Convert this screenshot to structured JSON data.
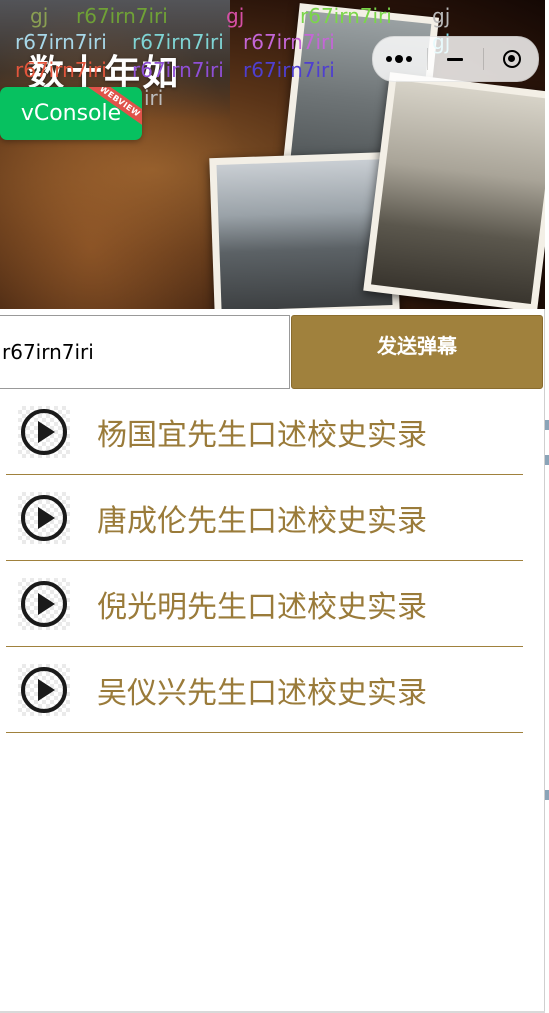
{
  "banner": {
    "title": "数十年如",
    "danmaku": [
      {
        "text": "gj",
        "color": "#8a9f52"
      },
      {
        "text": "r67irn7iri",
        "color": "#6fa136"
      },
      {
        "text": "gj",
        "color": "#d64fa5"
      },
      {
        "text": "r67irn7iri",
        "color": "#7bd64a"
      },
      {
        "text": "gj",
        "color": "#b9b9b9"
      },
      {
        "text": "r67irn7iri",
        "color": "#a7d7e8"
      },
      {
        "text": "r67irn7iri",
        "color": "#7fd4d4"
      },
      {
        "text": "r67irn7iri",
        "color": "#c466d6"
      },
      {
        "text": "gj",
        "color": "#7fe0ee"
      },
      {
        "text": "r67irn7iri",
        "color": "#e2553c"
      },
      {
        "text": "r67irn7iri",
        "color": "#8f4fd6"
      },
      {
        "text": "r67irn7iri",
        "color": "#4f3fcf"
      },
      {
        "text": "iri",
        "color": "#bdbdbd"
      }
    ]
  },
  "capsule": {
    "more_icon": "more-dots-icon",
    "minimize_icon": "minimize-icon",
    "close_icon": "target-close-icon"
  },
  "vconsole": {
    "label": "vConsole",
    "ribbon": "WEBVIEW"
  },
  "danmaku_bar": {
    "input_value": "r67irn7iri",
    "send_label": "发送弹幕"
  },
  "list": {
    "items": [
      {
        "label": "杨国宜先生口述校史实录"
      },
      {
        "label": "唐成伦先生口述校史实录"
      },
      {
        "label": "倪光明先生口述校史实录"
      },
      {
        "label": "吴仪兴先生口述校史实录"
      }
    ]
  },
  "colors": {
    "accent": "#a0813d",
    "label": "#9a7b3a",
    "vconsole_green": "#07c160"
  }
}
